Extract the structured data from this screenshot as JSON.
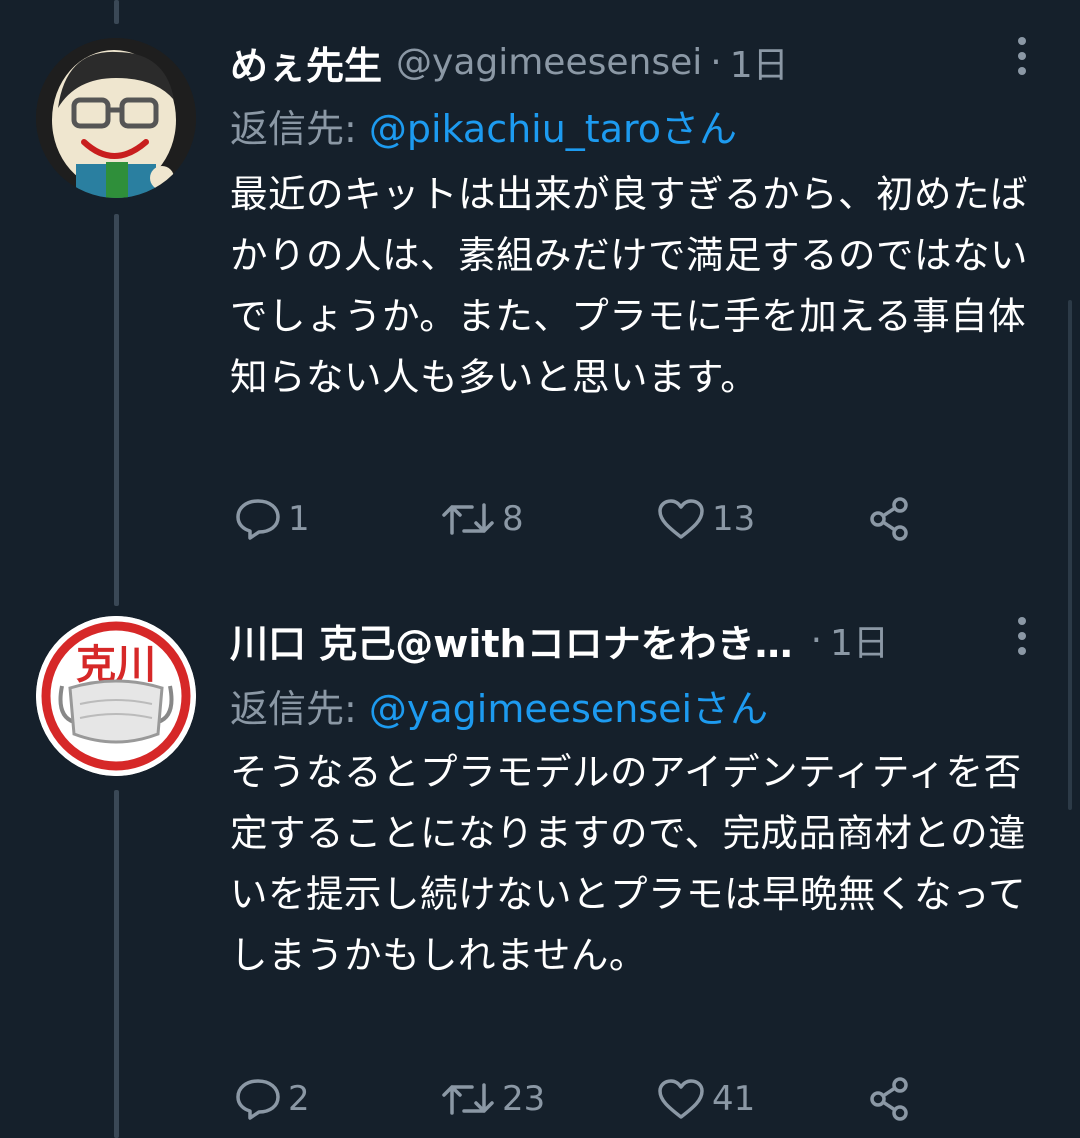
{
  "tweets": [
    {
      "name": "めぇ先生",
      "handle": "@yagimeesensei",
      "separator": "·",
      "time": "1日",
      "reply_label": "返信先: ",
      "reply_mention": "@pikachiu_taro",
      "reply_suffix": "さん",
      "body": "最近のキットは出来が良すぎるから、初めたばかりの人は、素組みだけで満足するのではないでしょうか。また、プラモに手を加える事自体知らない人も多いと思います。",
      "replies": "1",
      "retweets": "8",
      "likes": "13",
      "avatar_icon": "cartoon-teacher-avatar"
    },
    {
      "name": "川口 克己@withコロナをわき…",
      "handle": "",
      "separator": "·",
      "time": "1日",
      "reply_label": "返信先: ",
      "reply_mention": "@yagimeesensei",
      "reply_suffix": "さん",
      "body": "そうなるとプラモデルのアイデンティティを否定することになりますので、完成品商材との違いを提示し続けないとプラモは早晩無くなってしまうかもしれません。",
      "replies": "2",
      "retweets": "23",
      "likes": "41",
      "avatar_icon": "mask-logo-avatar",
      "avatar_text": "克川"
    }
  ],
  "colors": {
    "background": "#15202b",
    "secondary_text": "#8b98a5",
    "link": "#1d9bf0"
  }
}
